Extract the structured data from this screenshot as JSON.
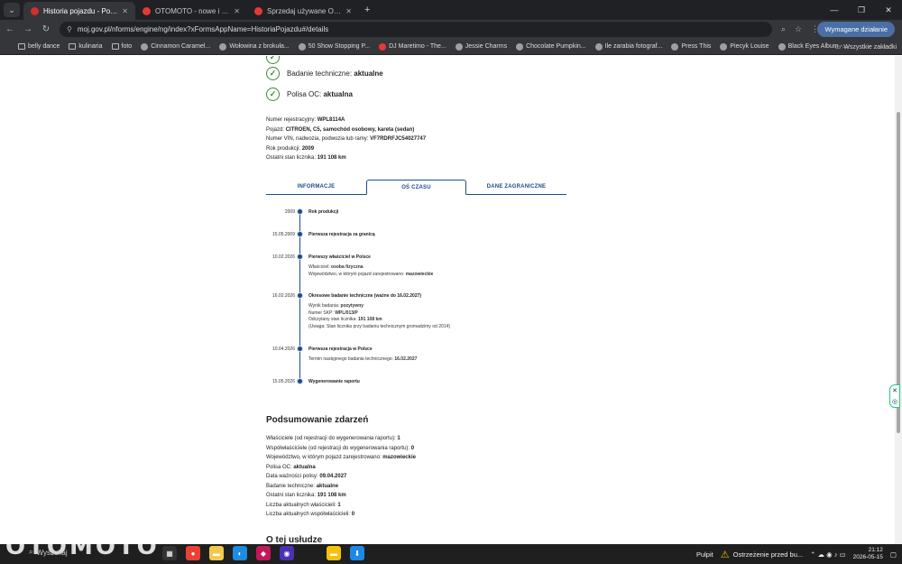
{
  "browser": {
    "tabs": [
      {
        "title": "Historia pojazdu - Portal gov.pl",
        "active": true,
        "color": "#d32f2f"
      },
      {
        "title": "OTOMOTO - nowe i używane s",
        "active": false,
        "color": "#e53935"
      },
      {
        "title": "Sprzedaj używane Osobowe | O",
        "active": false,
        "color": "#e53935"
      }
    ],
    "url": "moj.gov.pl/nforms/engine/ng/index?xFormsAppName=HistoriaPojazdu#/details",
    "action_label": "Wymagane działanie",
    "bookmarks": [
      {
        "label": "belly dance",
        "icon": "folder-icon"
      },
      {
        "label": "kulinaria",
        "icon": "folder-icon"
      },
      {
        "label": "foto",
        "icon": "folder-icon"
      },
      {
        "label": "Cinnamon Caramel...",
        "icon": "site-icon"
      },
      {
        "label": "Wołowina z brokuła...",
        "icon": "site-icon"
      },
      {
        "label": "50 Show Stopping P...",
        "icon": "site-icon"
      },
      {
        "label": "DJ Maretimo - The...",
        "icon": "youtube-icon"
      },
      {
        "label": "Jessie Charms",
        "icon": "site-icon"
      },
      {
        "label": "Chocolate Pumpkin...",
        "icon": "site-icon"
      },
      {
        "label": "Ile zarabia fotograf...",
        "icon": "site-icon"
      },
      {
        "label": "Press This",
        "icon": "site-icon"
      },
      {
        "label": "Piecyk Louise",
        "icon": "site-icon"
      },
      {
        "label": "Black Eyes Album -...",
        "icon": "site-icon"
      }
    ],
    "all_bookmarks": "Wszystkie zakładki"
  },
  "status": [
    {
      "label": "Badanie techniczne: ",
      "value": "aktualne"
    },
    {
      "label": "Polisa OC: ",
      "value": "aktualna"
    }
  ],
  "vehicle": [
    {
      "label": "Numer rejestracyjny: ",
      "value": "WPL8114A"
    },
    {
      "label": "Pojazd: ",
      "value": "CITROEN, C5, samochód osobowy, kareta (sedan)"
    },
    {
      "label": "Numer VIN, nadwozia, podwozia lub ramy: ",
      "value": "VF7RDRFJC54027747"
    },
    {
      "label": "Rok produkcji: ",
      "value": "2009"
    },
    {
      "label": "Ostatni stan licznika: ",
      "value": "191 108 km"
    }
  ],
  "page_tabs": [
    {
      "label": "INFORMACJE",
      "active": false
    },
    {
      "label": "OŚ CZASU",
      "active": true
    },
    {
      "label": "DANE ZAGRANICZNE",
      "active": false
    }
  ],
  "timeline": [
    {
      "date": "2009",
      "title": "Rok produkcji",
      "details": []
    },
    {
      "date": "15.05.2009",
      "title": "Pierwsza rejestracja za granicą",
      "details": []
    },
    {
      "date": "10.02.2026",
      "title": "Pierwszy właściciel w Polsce",
      "details": [
        {
          "label": "Właściciel: ",
          "value": "osoba fizyczna"
        },
        {
          "label": "Województwo, w którym pojazd zarejestrowano: ",
          "value": "mazowieckie"
        }
      ]
    },
    {
      "date": "16.02.2026",
      "title": "Okresowe badanie techniczne (ważne do 16.02.2027)",
      "details": [
        {
          "label": "Wynik badania: ",
          "value": "pozytywny"
        },
        {
          "label": "Numer SKP: ",
          "value": "WPL/013/P"
        },
        {
          "label": "Odczytany stan licznika: ",
          "value": "191 108 km"
        },
        {
          "label": "(Uwaga: Stan licznika przy badaniu technicznym gromadzimy od 2014)",
          "value": ""
        }
      ]
    },
    {
      "date": "10.04.2026",
      "title": "Pierwsza rejestracja w Polsce",
      "details": [
        {
          "label": "Termin następnego badania technicznego: ",
          "value": "16.02.2027"
        }
      ]
    },
    {
      "date": "15.05.2026",
      "title": "Wygenerowanie raportu",
      "details": []
    }
  ],
  "summary": {
    "title": "Podsumowanie zdarzeń",
    "rows": [
      {
        "label": "Właściciele (od rejestracji do wygenerowania raportu): ",
        "value": "1"
      },
      {
        "label": "Współwłaściciele (od rejestracji do wygenerowania raportu): ",
        "value": "0"
      },
      {
        "label": "Województwo, w którym pojazd zarejestrowano: ",
        "value": "mazowieckie"
      },
      {
        "label": "Polisa OC: ",
        "value": "aktualna"
      },
      {
        "label": "Data ważności polisy: ",
        "value": "09.04.2027"
      },
      {
        "label": "Badanie techniczne: ",
        "value": "aktualne"
      },
      {
        "label": "Ostatni stan licznika: ",
        "value": "191 108 km"
      },
      {
        "label": "Liczba aktualnych właścicieli: ",
        "value": "1"
      },
      {
        "label": "Liczba aktualnych współwłaścicieli: ",
        "value": "0"
      }
    ]
  },
  "about_title": "O tej usłudze",
  "taskbar": {
    "logo": "OTOMOTO",
    "search": "Wyszukaj",
    "desktop": "Pulpit",
    "warning": "Ostrzeżenie przed bu...",
    "time": "21:12",
    "date": "2026-05-15"
  }
}
